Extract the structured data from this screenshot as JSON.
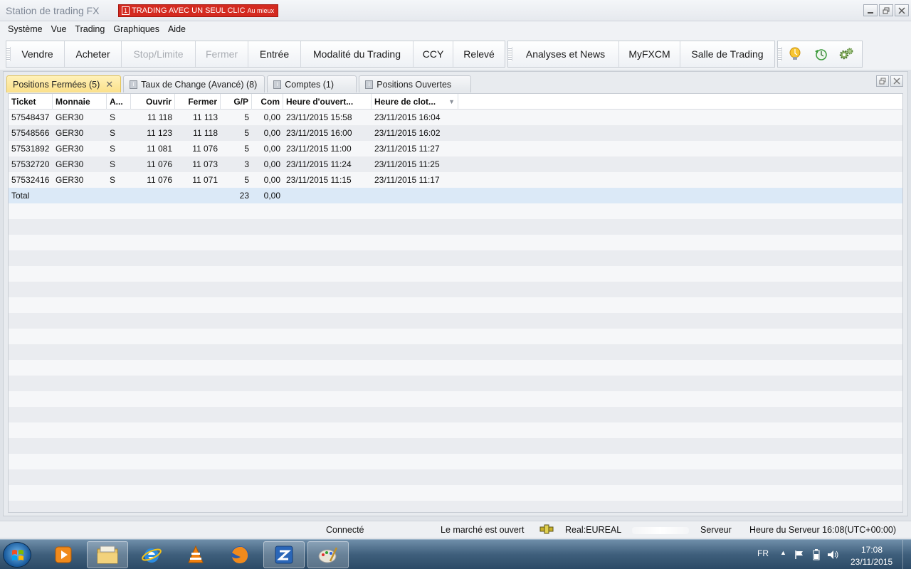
{
  "window": {
    "title": "Station de trading FX",
    "promo_badge": "1",
    "promo_text": "TRADING AVEC UN SEUL CLIC",
    "promo_suffix": "Au mieux"
  },
  "menu": [
    "Système",
    "Vue",
    "Trading",
    "Graphiques",
    "Aide"
  ],
  "toolbar": {
    "group1": [
      {
        "label": "Vendre",
        "enabled": true
      },
      {
        "label": "Acheter",
        "enabled": true
      },
      {
        "label": "Stop/Limite",
        "enabled": false
      },
      {
        "label": "Fermer",
        "enabled": false
      },
      {
        "label": "Entrée",
        "enabled": true
      },
      {
        "label": "Modalité du Trading",
        "enabled": true
      },
      {
        "label": "CCY",
        "enabled": true
      },
      {
        "label": "Relevé",
        "enabled": true
      }
    ],
    "group2": [
      "Analyses et News",
      "MyFXCM",
      "Salle de Trading"
    ],
    "icons": [
      "lightbulb-icon",
      "history-clock-icon",
      "gears-icon"
    ]
  },
  "tabs": [
    {
      "label": "Positions Fermées (5)",
      "active": true,
      "closable": true
    },
    {
      "label": "Taux de Change (Avancé) (8)",
      "active": false,
      "closable": false
    },
    {
      "label": "Comptes (1)",
      "active": false,
      "closable": false
    },
    {
      "label": "Positions Ouvertes",
      "active": false,
      "closable": false
    }
  ],
  "tab_icon_glyph": "i",
  "table": {
    "columns": [
      "Ticket",
      "Monnaie",
      "A...",
      "Ouvrir",
      "Fermer",
      "G/P",
      "Com",
      "Heure d'ouvert...",
      "Heure de clot..."
    ],
    "rows": [
      [
        "57548437",
        "GER30",
        "S",
        "11 118",
        "11 113",
        "5",
        "0,00",
        "23/11/2015 15:58",
        "23/11/2015 16:04"
      ],
      [
        "57548566",
        "GER30",
        "S",
        "11 123",
        "11 118",
        "5",
        "0,00",
        "23/11/2015 16:00",
        "23/11/2015 16:02"
      ],
      [
        "57531892",
        "GER30",
        "S",
        "11 081",
        "11 076",
        "5",
        "0,00",
        "23/11/2015 11:00",
        "23/11/2015 11:27"
      ],
      [
        "57532720",
        "GER30",
        "S",
        "11 076",
        "11 073",
        "3",
        "0,00",
        "23/11/2015 11:24",
        "23/11/2015 11:25"
      ],
      [
        "57532416",
        "GER30",
        "S",
        "11 076",
        "11 071",
        "5",
        "0,00",
        "23/11/2015 11:15",
        "23/11/2015 11:17"
      ]
    ],
    "total": {
      "label": "Total",
      "gp": "23",
      "com": "0,00"
    }
  },
  "status": {
    "connection": "Connecté",
    "market": "Le marché est ouvert",
    "account": "Real:EUREAL",
    "server_label": "Serveur",
    "server_time": "Heure du Serveur 16:08(UTC+00:00)"
  },
  "taskbar": {
    "apps": [
      "media-player-icon",
      "file-explorer-icon",
      "internet-explorer-icon",
      "vlc-icon",
      "firefox-icon",
      "fxcm-trading-station-icon",
      "paint-icon"
    ],
    "lang": "FR",
    "time": "17:08",
    "date": "23/11/2015"
  }
}
